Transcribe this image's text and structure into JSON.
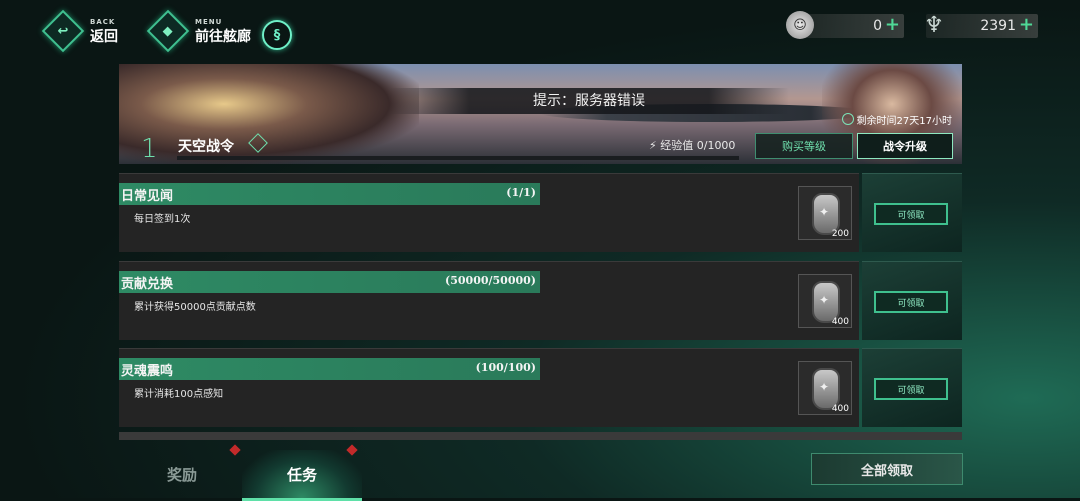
{
  "nav": {
    "back_small": "BACK",
    "back_label": "返回",
    "menu_small": "MENU",
    "menu_label": "前往舷廊"
  },
  "currency": [
    {
      "icon": "coin-icon",
      "value": "0",
      "plus": "+"
    },
    {
      "icon": "crystal-icon",
      "value": "2391",
      "plus": "+"
    }
  ],
  "banner": {
    "notice": "提示：服务器错误",
    "level": "1",
    "pass_name": "天空战令",
    "exp_label": "经验值",
    "exp_value": "0/1000",
    "exp_progress": 0,
    "time_left": "剩余时间27天17小时",
    "buy_level_label": "购买等级",
    "upgrade_label": "战令升级"
  },
  "tasks": [
    {
      "title": "日常见闻",
      "progress": "(1/1)",
      "desc": "每日签到1次",
      "reward_amount": "200",
      "claim_label": "可领取"
    },
    {
      "title": "贡献兑换",
      "progress": "(50000/50000)",
      "desc": "累计获得50000点贡献点数",
      "reward_amount": "400",
      "claim_label": "可领取"
    },
    {
      "title": "灵魂震鸣",
      "progress": "(100/100)",
      "desc": "累计消耗100点感知",
      "reward_amount": "400",
      "claim_label": "可领取"
    }
  ],
  "tabs": {
    "rewards": "奖励",
    "tasks": "任务",
    "active": "tasks"
  },
  "claim_all_label": "全部领取",
  "colors": {
    "accent": "#2e8a64",
    "accent_light": "#6fe0ad",
    "badge": "#c22a2a"
  }
}
